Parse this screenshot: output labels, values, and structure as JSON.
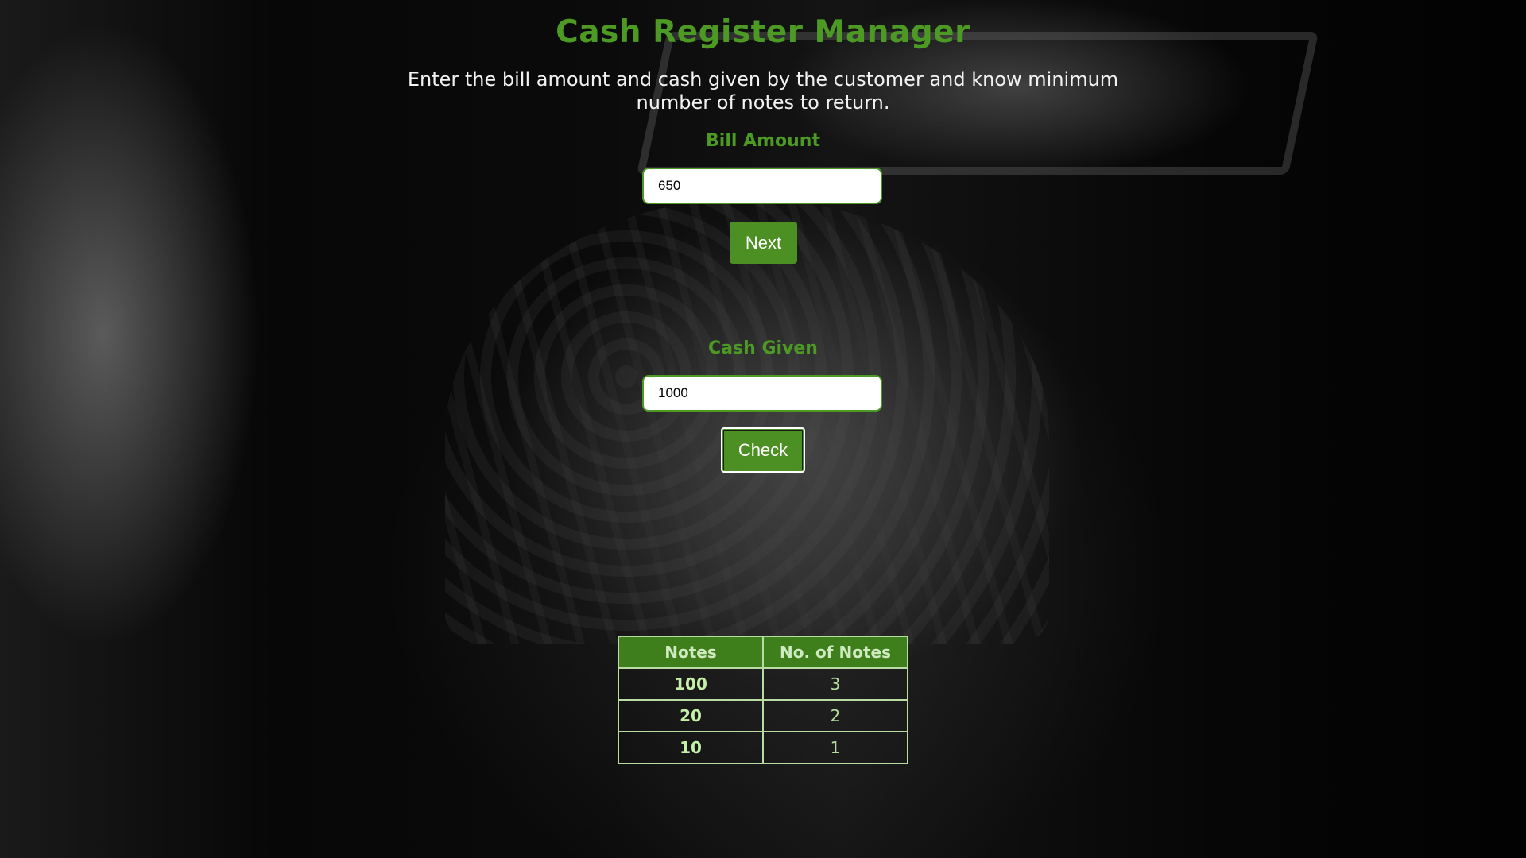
{
  "app": {
    "title": "Cash Register Manager",
    "description": "Enter the bill amount and cash given by the customer and know minimum number of notes to return."
  },
  "bill": {
    "label": "Bill Amount",
    "value": "650",
    "next_label": "Next"
  },
  "cash": {
    "label": "Cash Given",
    "value": "1000",
    "check_label": "Check"
  },
  "table": {
    "headers": [
      "Notes",
      "No. of Notes"
    ],
    "rows": [
      {
        "note": "100",
        "count": "3"
      },
      {
        "note": "20",
        "count": "2"
      },
      {
        "note": "10",
        "count": "1"
      }
    ]
  },
  "colors": {
    "accent": "#4c9a24",
    "button": "#4c8f23",
    "table_header": "#3e7f1c",
    "table_border": "#b8dca3"
  }
}
